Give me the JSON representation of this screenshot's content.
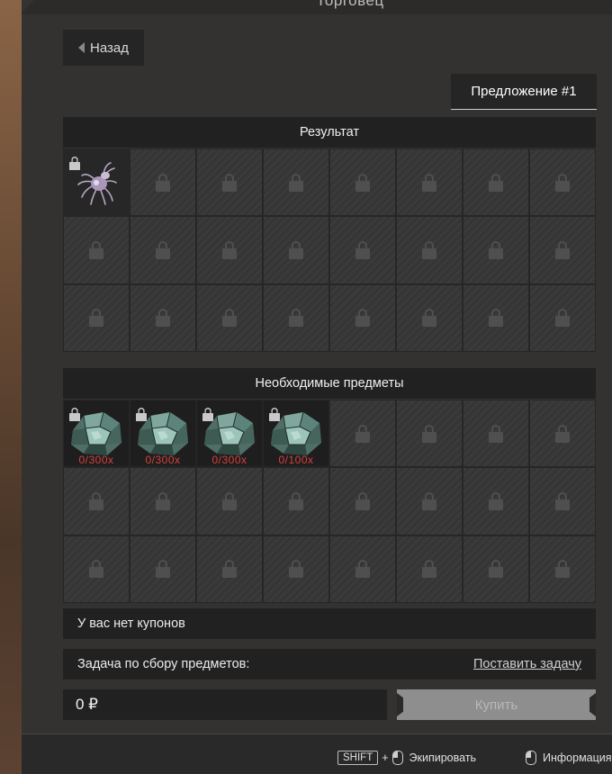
{
  "window": {
    "title": "Торговец"
  },
  "nav": {
    "back_label": "Назад"
  },
  "offer_tab": {
    "label": "Предложение #1"
  },
  "result_section": {
    "title": "Результат",
    "items": [
      {
        "icon": "spider-creature-icon",
        "locked": true
      }
    ]
  },
  "required_section": {
    "title": "Необходимые предметы",
    "items": [
      {
        "icon": "teal-crystal-ore-icon",
        "qty": "0/300x",
        "locked": true
      },
      {
        "icon": "teal-crystal-ore-icon",
        "qty": "0/300x",
        "locked": true
      },
      {
        "icon": "teal-crystal-ore-icon",
        "qty": "0/300x",
        "locked": true
      },
      {
        "icon": "teal-crystal-ore-icon",
        "qty": "0/100x",
        "locked": true
      }
    ]
  },
  "coupons": {
    "text": "У вас нет купонов"
  },
  "collection_task": {
    "label": "Задача по сбору предметов:",
    "link": "Поставить задачу"
  },
  "purchase": {
    "price": "0 ₽",
    "buy_label": "Купить"
  },
  "footer": {
    "shift_key": "SHIFT",
    "plus": "+",
    "equip_label": "Экипировать",
    "info_label": "Информация"
  },
  "colors": {
    "quantity_text": "#d8403c",
    "panel": "#333231",
    "buy_disabled": "#8e8e8e"
  }
}
